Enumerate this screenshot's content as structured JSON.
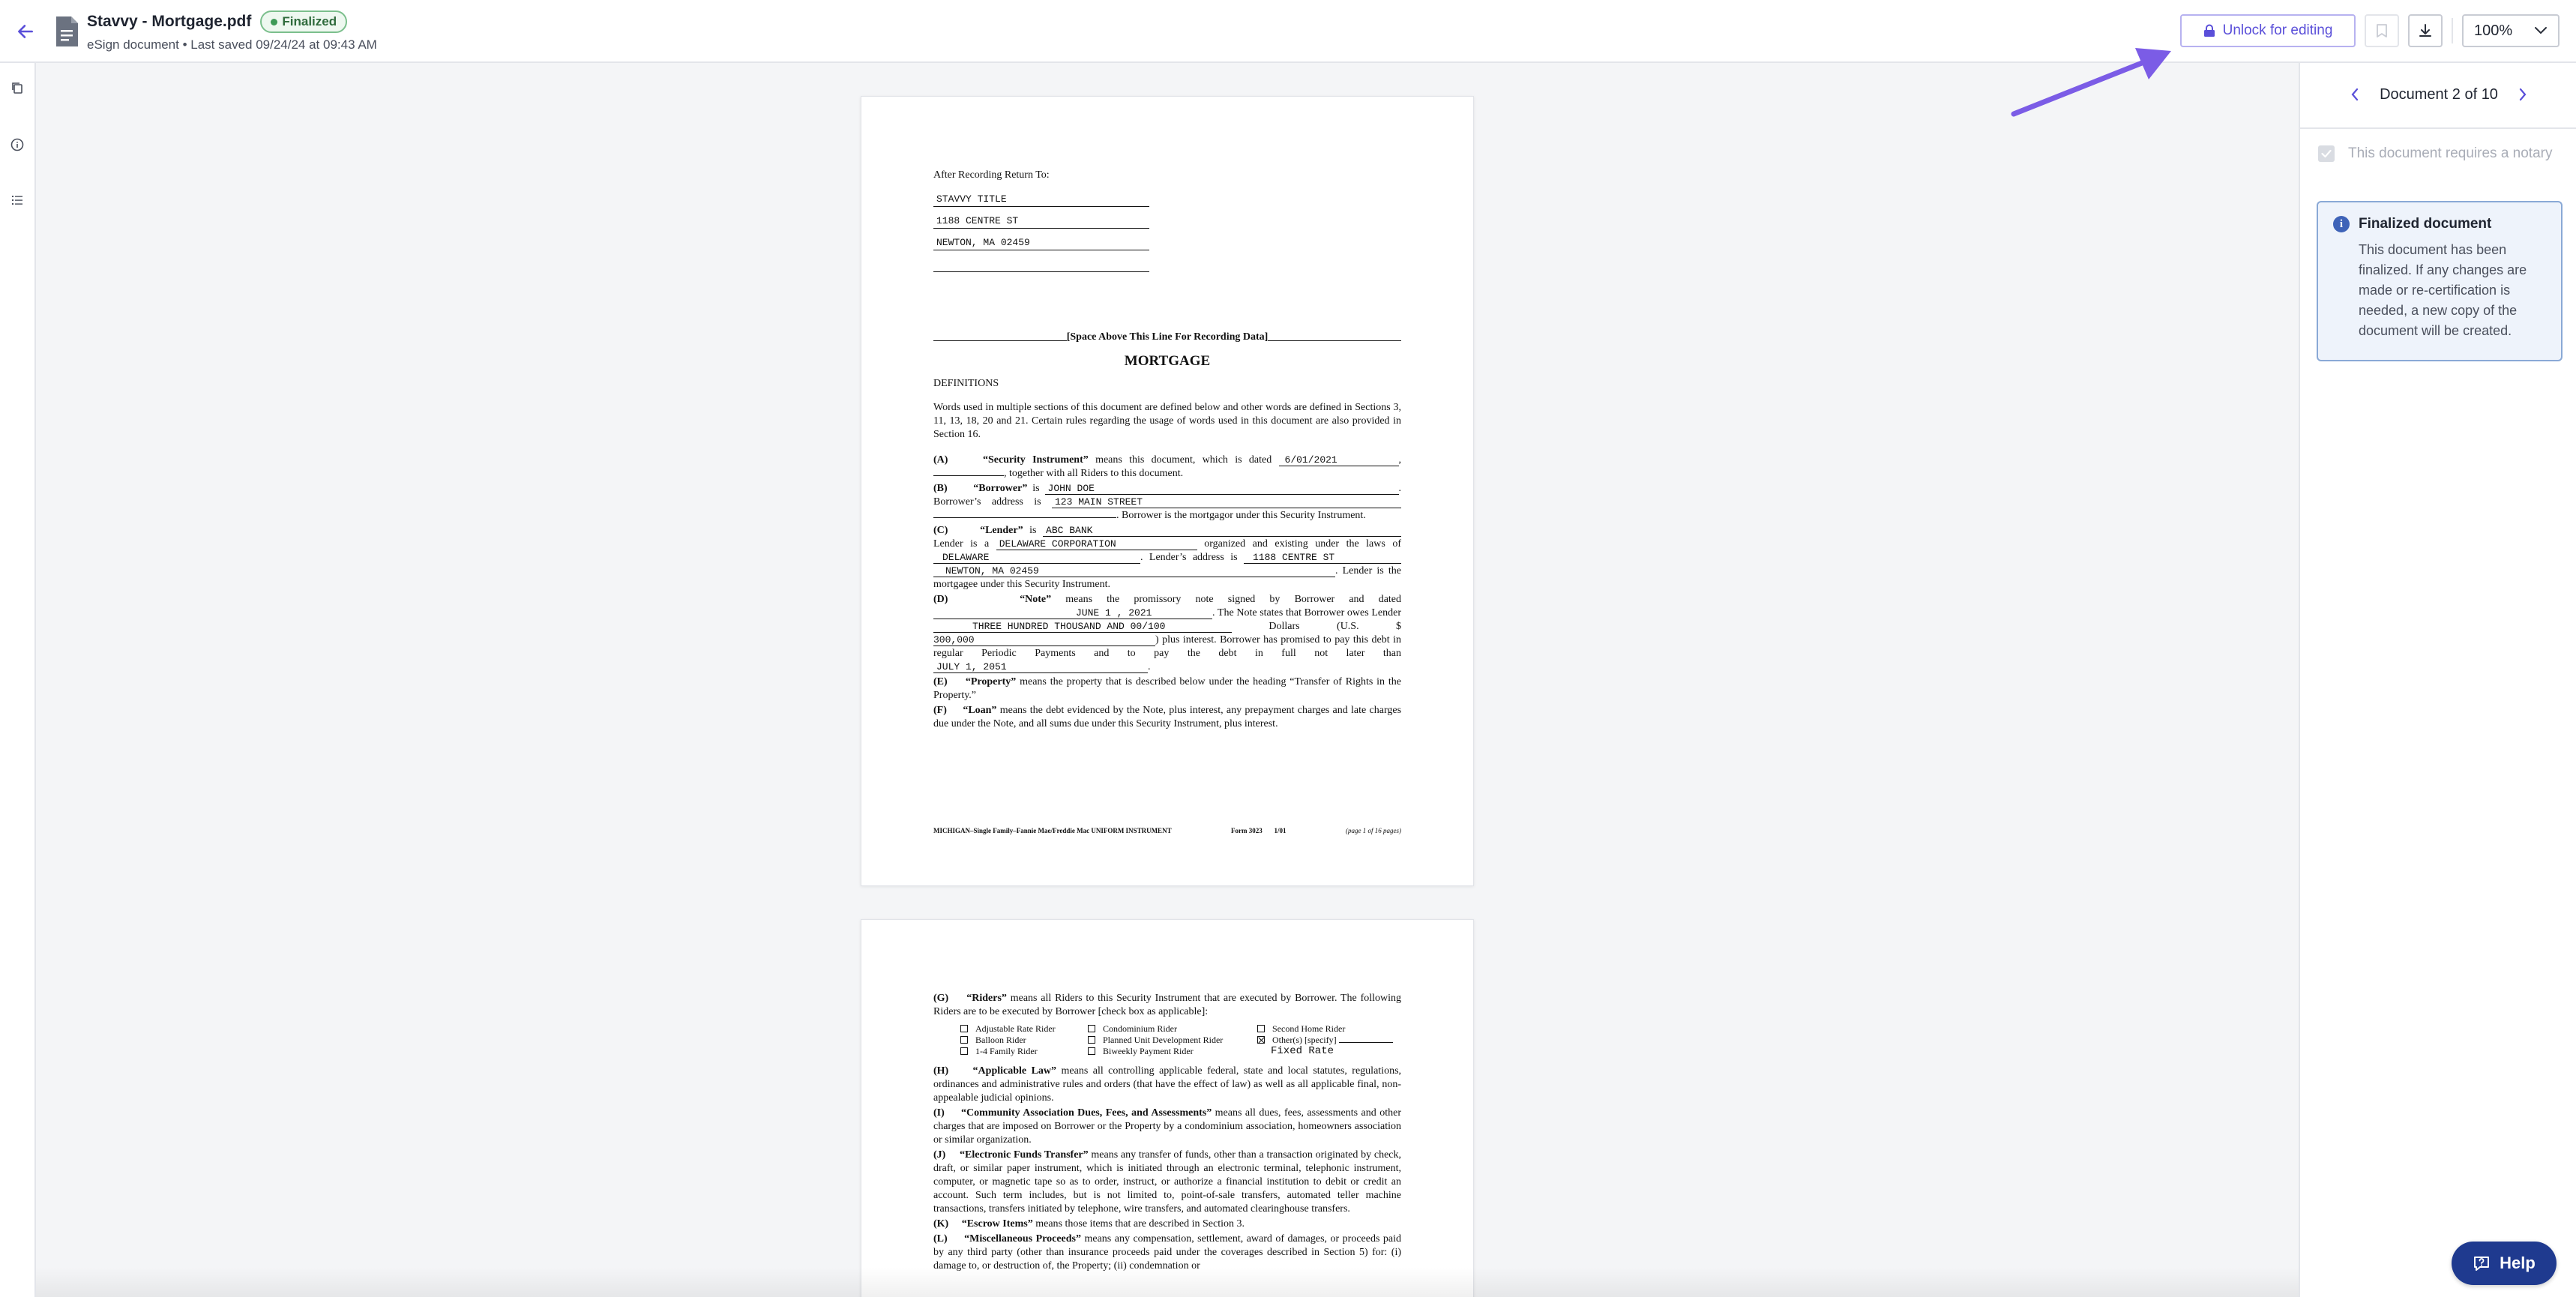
{
  "header": {
    "file_name": "Stavvy - Mortgage.pdf",
    "status": "Finalized",
    "subtitle": "eSign document • Last saved 09/24/24 at 09:43 AM",
    "unlock_label": "Unlock for editing",
    "zoom": "100%"
  },
  "icons": {
    "back": "arrow-left-icon",
    "file": "document-icon",
    "lock": "lock-icon",
    "bookmark": "bookmark-icon",
    "download": "download-icon",
    "chevron": "chevron-down-icon",
    "rail": [
      "copy-icon",
      "info-icon",
      "list-icon"
    ],
    "help": "help-icon"
  },
  "colors": {
    "accent": "#5a4fd9",
    "status_green": "#3e9a57",
    "info_blue": "#3e63b8",
    "help_bg": "#1f3a8f",
    "annotation_arrow": "#7b5ce6"
  },
  "right_panel": {
    "doc_nav": "Document 2 of 10",
    "notary_label": "This document requires a notary",
    "notary_checked": true,
    "info_title": "Finalized document",
    "info_body": "This document has been finalized. If any changes are made or re-certification is needed, a new copy of the document will be created."
  },
  "help_label": "Help",
  "page1": {
    "return_to": "After Recording Return To:",
    "addr": [
      "STAVVY TITLE",
      "1188 CENTRE ST",
      "NEWTON, MA 02459",
      ""
    ],
    "recording_line": "[Space Above This Line For Recording Data]",
    "title": "MORTGAGE",
    "definitions": "DEFINITIONS",
    "intro": "Words used in multiple sections of this document are defined below and other words are defined in Sections 3, 11, 13, 18, 20 and 21. Certain rules regarding the usage of words used in this document are also provided in Section 16.",
    "a_label": "(A)",
    "a_term": "“Security Instrument”",
    "a_text1": "means this document, which is dated",
    "a_date": "6/01/2021",
    "a_text2": ", together with all Riders to this document.",
    "b_label": "(B)",
    "b_term": "“Borrower”",
    "b_is": "is",
    "b_name": "JOHN DOE",
    "b_addr_label": "Borrower’s address is",
    "b_addr": "123 MAIN STREET",
    "b_text2": ". Borrower is the mortgagor under this Security Instrument.",
    "c_label": "(C)",
    "c_term": "“Lender”",
    "c_is": "is",
    "c_name": "ABC BANK",
    "c_text1": "Lender is a",
    "c_org": "DELAWARE CORPORATION",
    "c_text2": "organized and existing under the laws of",
    "c_state": "DELAWARE",
    "c_text3": ". Lender’s address is",
    "c_addr": "1188 CENTRE ST",
    "c_city": "NEWTON, MA 02459",
    "c_text4": ". Lender is the mortgagee under this Security Instrument.",
    "d_label": "(D)",
    "d_term": "“Note”",
    "d_text1": "means the promissory note signed by Borrower and dated",
    "d_date": "JUNE 1 , 2021",
    "d_text2": ". The Note states that Borrower owes Lender",
    "d_amount_words": "THREE HUNDRED THOUSAND AND 00/100",
    "d_text3": "Dollars (U.S. $",
    "d_amount": "300,000",
    "d_text4": ") plus interest. Borrower has promised to pay this debt in regular Periodic Payments and to pay the debt in full not later than",
    "d_maturity": "JULY 1, 2051",
    "e_label": "(E)",
    "e_term": "“Property”",
    "e_text": "means the property that is described below under the heading “Transfer of Rights in the Property.”",
    "f_label": "(F)",
    "f_term": "“Loan”",
    "f_text": "means the debt evidenced by the Note, plus interest, any prepayment charges and late charges due under the Note, and all sums due under this Security Instrument, plus interest.",
    "footer_left": "MICHIGAN–Single Family–Fannie Mae/Freddie Mac UNIFORM INSTRUMENT",
    "footer_form": "Form 3023",
    "footer_date": "1/01",
    "footer_page": "(page 1 of 16 pages)"
  },
  "page2": {
    "g_label": "(G)",
    "g_term": "“Riders”",
    "g_text": "means all Riders to this Security Instrument that are executed by Borrower. The following Riders are to be executed by Borrower [check box as applicable]:",
    "riders": [
      {
        "label": "Adjustable Rate Rider",
        "checked": false
      },
      {
        "label": "Condominium Rider",
        "checked": false
      },
      {
        "label": "Second Home Rider",
        "checked": false
      },
      {
        "label": "Balloon Rider",
        "checked": false
      },
      {
        "label": "Planned Unit Development Rider",
        "checked": false
      },
      {
        "label": "Other(s) [specify]",
        "checked": true
      },
      {
        "label": "1-4 Family Rider",
        "checked": false
      },
      {
        "label": "Biweekly Payment Rider",
        "checked": false
      }
    ],
    "other_value": "Fixed Rate",
    "h_label": "(H)",
    "h_term": "“Applicable Law”",
    "h_text": "means all controlling applicable federal, state and local statutes, regulations, ordinances and administrative rules and orders (that have the effect of law) as well as all applicable final, non-appealable judicial opinions.",
    "i_label": "(I)",
    "i_term": "“Community Association Dues, Fees, and Assessments”",
    "i_text": "means all dues, fees, assessments and other charges that are imposed on Borrower or the Property by a condominium association, homeowners association or similar organization.",
    "j_label": "(J)",
    "j_term": "“Electronic Funds Transfer”",
    "j_text": "means any transfer of funds, other than a transaction originated by check, draft, or similar paper instrument, which is initiated through an electronic terminal, telephonic instrument, computer, or magnetic tape so as to order, instruct, or authorize a financial institution to debit or credit an account. Such term includes, but is not limited to, point-of-sale transfers, automated teller machine transactions, transfers initiated by telephone, wire transfers, and automated clearinghouse transfers.",
    "k_label": "(K)",
    "k_term": "“Escrow Items”",
    "k_text": "means those items that are described in Section 3.",
    "l_label": "(L)",
    "l_term": "“Miscellaneous Proceeds”",
    "l_text": "means any compensation, settlement, award of damages, or proceeds paid by any third party (other than insurance proceeds paid under the coverages described in Section 5) for: (i) damage to, or destruction of, the Property; (ii) condemnation or"
  }
}
